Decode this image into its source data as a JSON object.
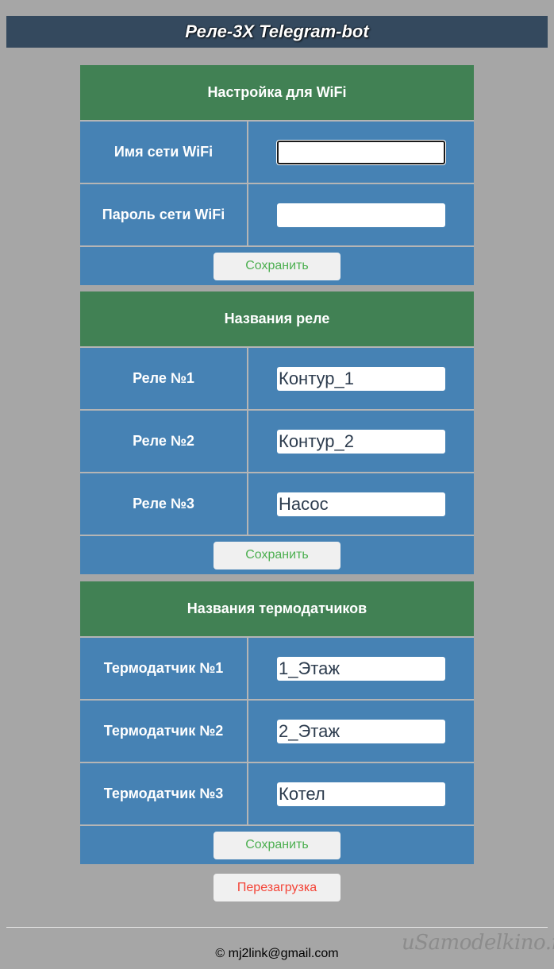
{
  "header": {
    "title": "Реле-3X Telegram-bot"
  },
  "wifi": {
    "title": "Настройка для WiFi",
    "fields": [
      {
        "label": "Имя сети WiFi",
        "value": ""
      },
      {
        "label": "Пароль сети WiFi",
        "value": ""
      }
    ],
    "save_label": "Сохранить"
  },
  "relays": {
    "title": "Названия реле",
    "fields": [
      {
        "label": "Реле №1",
        "value": "Контур_1"
      },
      {
        "label": "Реле №2",
        "value": "Контур_2"
      },
      {
        "label": "Реле №3",
        "value": "Насос"
      }
    ],
    "save_label": "Сохранить"
  },
  "sensors": {
    "title": "Названия термодатчиков",
    "fields": [
      {
        "label": "Термодатчик №1",
        "value": "1_Этаж"
      },
      {
        "label": "Термодатчик №2",
        "value": "2_Этаж"
      },
      {
        "label": "Термодатчик №3",
        "value": "Котел"
      }
    ],
    "save_label": "Сохранить"
  },
  "reboot_label": "Перезагрузка",
  "footer": {
    "email": "© mj2link@gmail.com"
  },
  "watermark": "uSamodelkino.ru",
  "colors": {
    "page_bg": "#a6a6a6",
    "topbar_bg": "#34495e",
    "section_header_bg": "#418154",
    "section_body_bg": "#4682b4",
    "save_text": "#4caf50",
    "reboot_text": "#f44336"
  }
}
